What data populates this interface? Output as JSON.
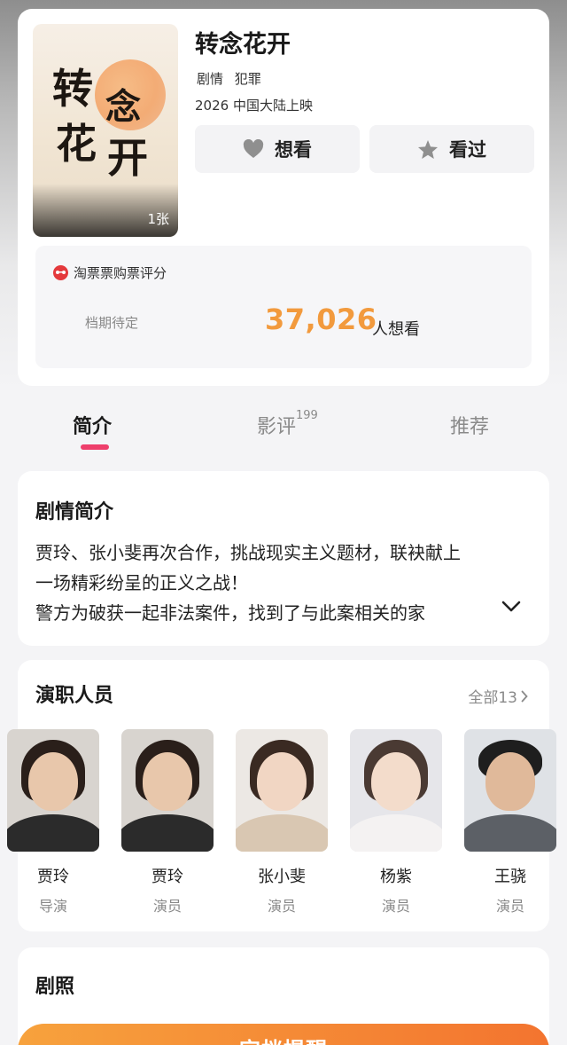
{
  "movie": {
    "title": "转念花开",
    "genres": [
      "剧情",
      "犯罪"
    ],
    "release": "2026 中国大陆上映",
    "poster_count": "1张",
    "poster_calligraphy": [
      "转",
      "念",
      "花",
      "开"
    ],
    "want_label": "想看",
    "seen_label": "看过"
  },
  "rating": {
    "source": "淘票票购票评分",
    "schedule": "档期待定",
    "want_count": "37,026",
    "want_suffix": "人想看"
  },
  "tabs": {
    "intro": "简介",
    "reviews": "影评",
    "reviews_count": "199",
    "recommend": "推荐"
  },
  "synopsis": {
    "title": "剧情简介",
    "lines": [
      "贾玲、张小斐再次合作，挑战现实主义题材，联袂献上",
      "一场精彩纷呈的正义之战！",
      "警方为破获一起非法案件，找到了与此案相关的家"
    ]
  },
  "cast": {
    "title": "演职人员",
    "all_label": "全部13",
    "members": [
      {
        "name": "贾玲",
        "role": "导演"
      },
      {
        "name": "贾玲",
        "role": "演员"
      },
      {
        "name": "张小斐",
        "role": "演员"
      },
      {
        "name": "杨紫",
        "role": "演员"
      },
      {
        "name": "王骁",
        "role": "演员"
      }
    ]
  },
  "stills": {
    "title": "剧照"
  },
  "cta": {
    "label": "定档提醒"
  },
  "colors": {
    "accent_orange": "#f29a3d",
    "tab_underline": "#ee3f6b",
    "cta_start": "#f7a23d",
    "cta_end": "#f3742f"
  }
}
